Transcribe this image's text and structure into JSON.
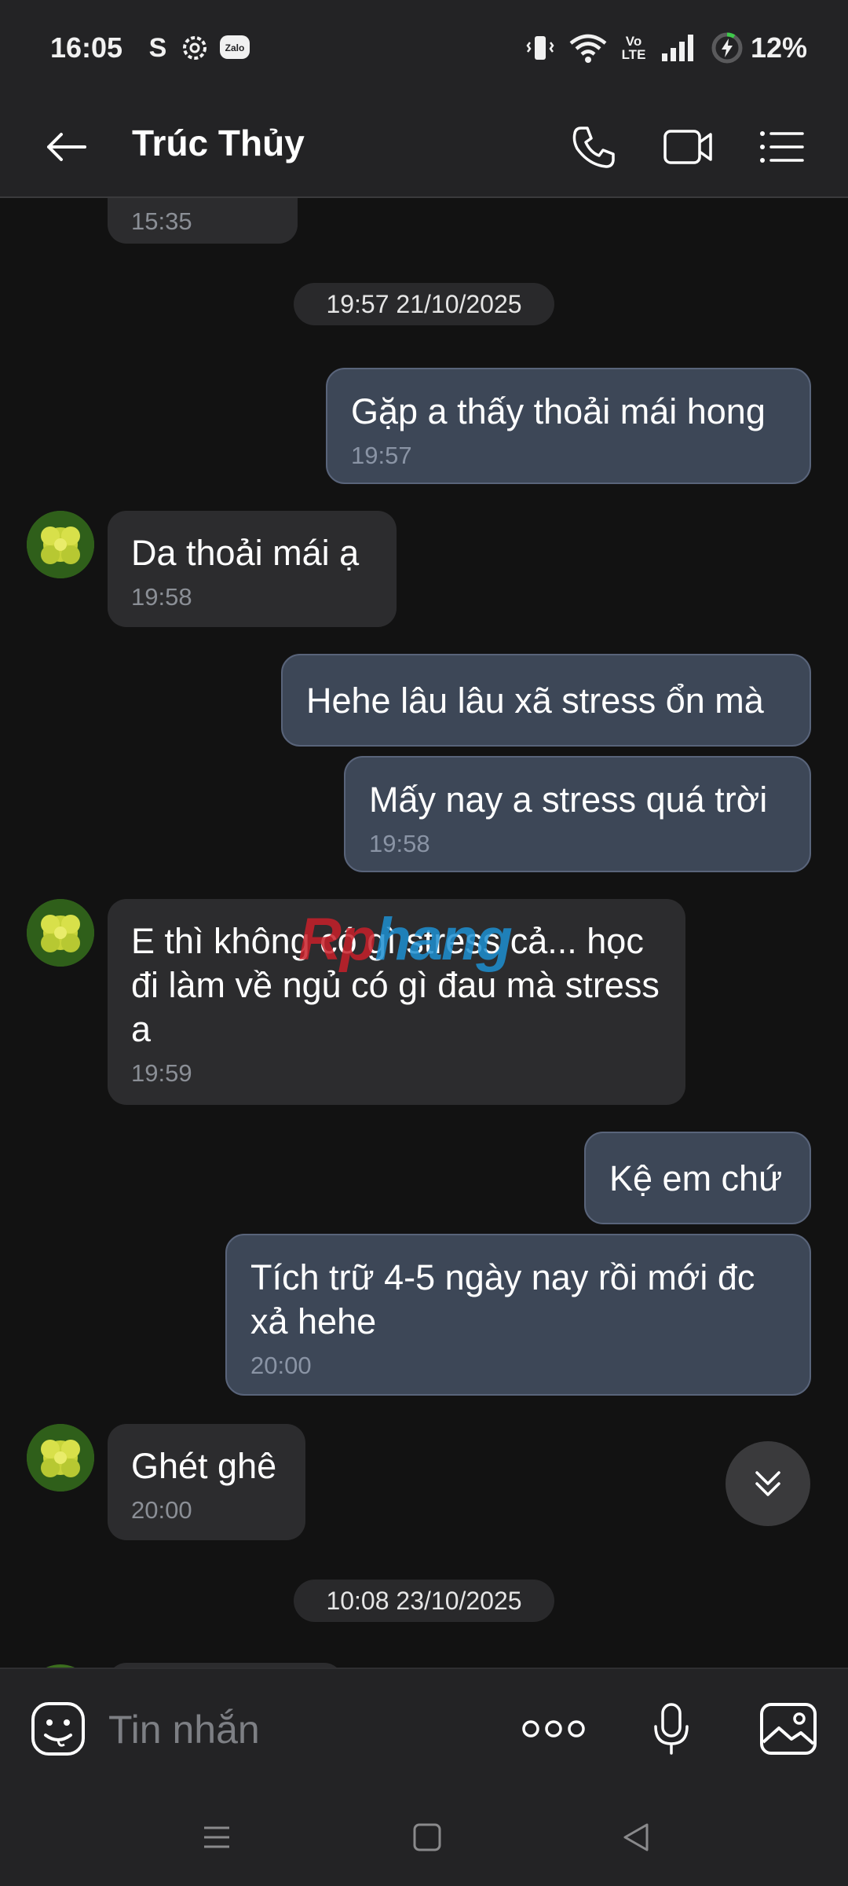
{
  "status_bar": {
    "time": "16:05",
    "battery": "12%",
    "network": "Vo LTE"
  },
  "header": {
    "contact_name": "Trúc Thủy"
  },
  "conversation": {
    "prev_message_time": "15:35",
    "date_dividers": [
      "19:57 21/10/2025",
      "10:08 23/10/2025"
    ],
    "messages": [
      {
        "dir": "out",
        "text": "Gặp a thấy thoải mái hong",
        "time": "19:57"
      },
      {
        "dir": "in",
        "text": "Da thoải mái ạ",
        "time": "19:58"
      },
      {
        "dir": "out",
        "text": "Hehe lâu lâu xã stress ổn mà",
        "time": ""
      },
      {
        "dir": "out",
        "text": "Mấy nay a stress quá trời",
        "time": "19:58"
      },
      {
        "dir": "in",
        "text": "E thì không có gì stress cả... học đi làm về ngủ có gì đau mà stress a",
        "time": "19:59"
      },
      {
        "dir": "out",
        "text": "Kệ em chứ",
        "time": ""
      },
      {
        "dir": "out",
        "text": "Tích trữ 4-5 ngày nay rồi mới đc xả hehe",
        "time": "20:00"
      },
      {
        "dir": "in",
        "text": "Ghét ghê",
        "time": "20:00"
      }
    ]
  },
  "watermark": {
    "part1": "Rp",
    "part2": "hang"
  },
  "input": {
    "placeholder": "Tin nhắn"
  },
  "colors": {
    "incoming_bubble": "#2c2c2e",
    "outgoing_bubble": "#3d4757",
    "background": "#121212",
    "bar": "#232325"
  }
}
